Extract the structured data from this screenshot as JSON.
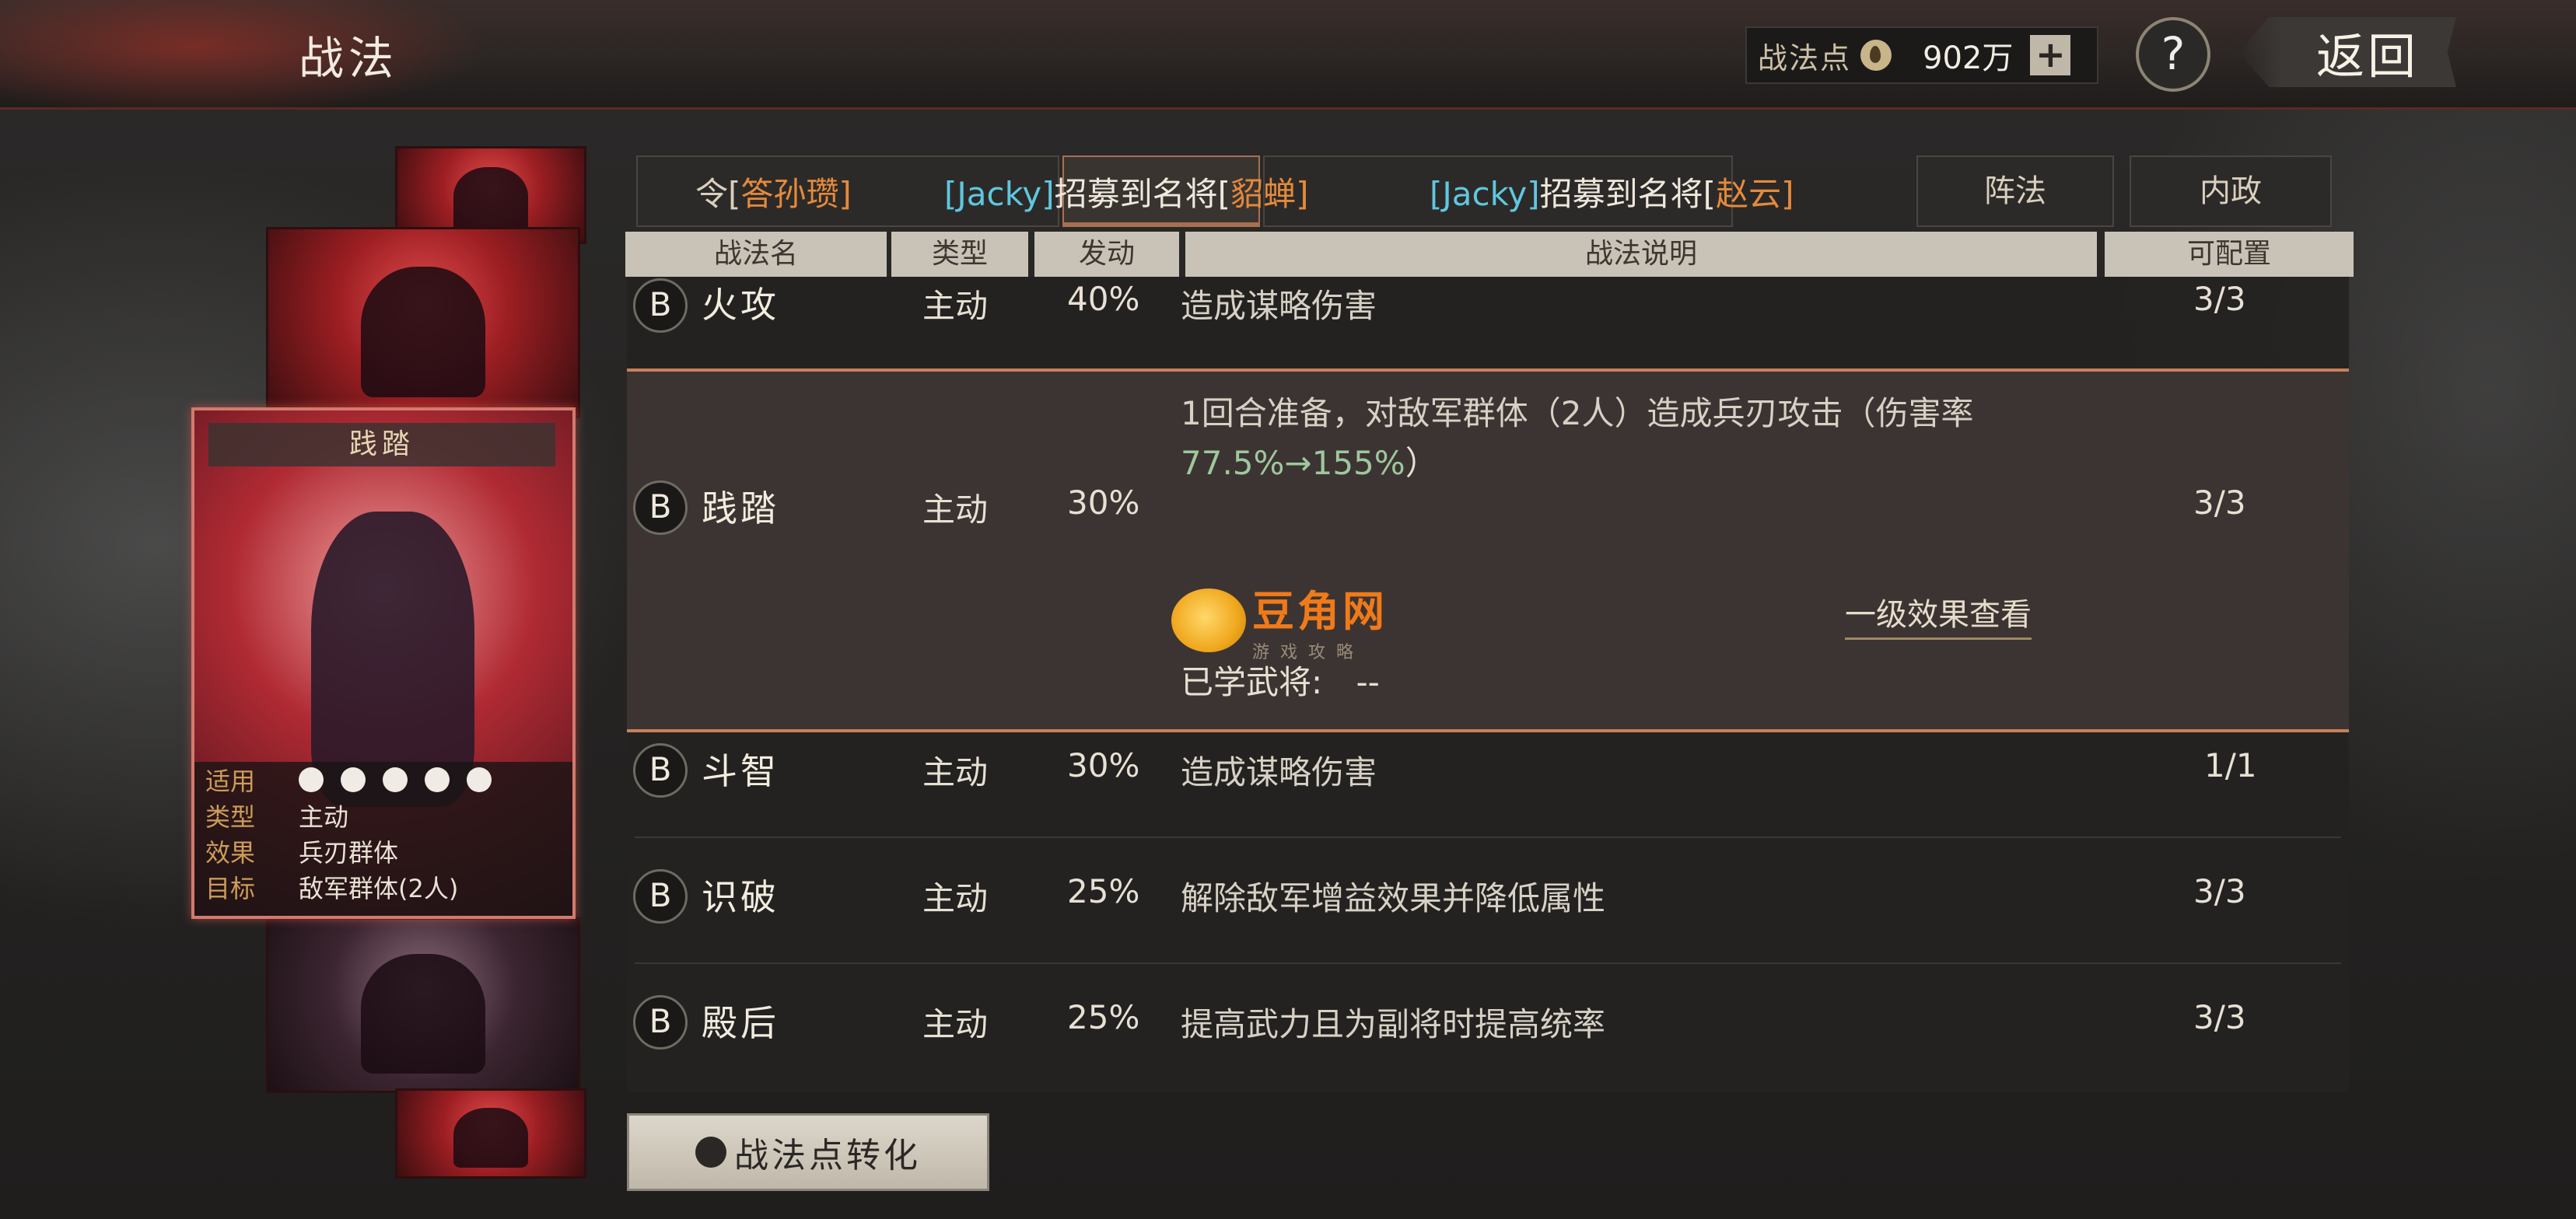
{
  "header": {
    "title": "战法",
    "points_label": "战法点",
    "points_value": "902万",
    "plus_label": "+",
    "help_label": "?",
    "back_label": "返回"
  },
  "card": {
    "name": "践踏",
    "info": [
      {
        "key": "适用",
        "value": ""
      },
      {
        "key": "类型",
        "value": "主动"
      },
      {
        "key": "效果",
        "value": "兵刃群体"
      },
      {
        "key": "目标",
        "value": "敌军群体(2人)"
      }
    ],
    "applicable_icons": [
      "cavalry-icon",
      "shield-icon",
      "crossed-blades-icon",
      "bow-icon",
      "wheel-icon"
    ]
  },
  "tabs": {
    "overlay_left_1": "令[",
    "overlay_left_name": "答孙瓒]",
    "overlay_mid_1": "[Jacky]",
    "overlay_mid_2": "招募到名将[",
    "overlay_mid_name": "貂蝉]",
    "overlay_right_1": "[Jacky]",
    "overlay_right_2": "招募到名将[",
    "overlay_right_name": "赵云]",
    "formation": "阵法",
    "internal": "内政"
  },
  "table": {
    "headers": {
      "name": "战法名",
      "type": "类型",
      "trigger": "发动",
      "desc": "战法说明",
      "config": "可配置"
    },
    "rows": [
      {
        "grade": "B",
        "name": "火攻",
        "type": "主动",
        "trigger": "40%",
        "desc": "造成谋略伤害",
        "config": "3/3"
      },
      {
        "grade": "B",
        "name": "践踏",
        "type": "主动",
        "trigger": "30%",
        "desc": "1回合准备，对敌军群体（2人）造成兵刃攻击（伤害率",
        "desc2": "77.5%→155%",
        "desc2_end": "）",
        "config": "3/3",
        "effect_link": "一级效果查看",
        "learned_label": "已学武将:",
        "learned_value": "--"
      },
      {
        "grade": "B",
        "name": "斗智",
        "type": "主动",
        "trigger": "30%",
        "desc": "造成谋略伤害",
        "config": "1/1"
      },
      {
        "grade": "B",
        "name": "识破",
        "type": "主动",
        "trigger": "25%",
        "desc": "解除敌军增益效果并降低属性",
        "config": "3/3"
      },
      {
        "grade": "B",
        "name": "殿后",
        "type": "主动",
        "trigger": "25%",
        "desc": "提高武力且为副将时提高统率",
        "config": "3/3"
      }
    ]
  },
  "watermark": {
    "main": "豆角网",
    "sub": "游戏攻略"
  },
  "convert_button": "战法点转化",
  "colors": {
    "accent": "#c8805a",
    "card_border": "#d37a6c",
    "watermark": "#f07a1a",
    "highlight_green": "#9fc79c",
    "overlay_cyan": "#5fc7e0",
    "overlay_orange": "#e48a3c"
  }
}
